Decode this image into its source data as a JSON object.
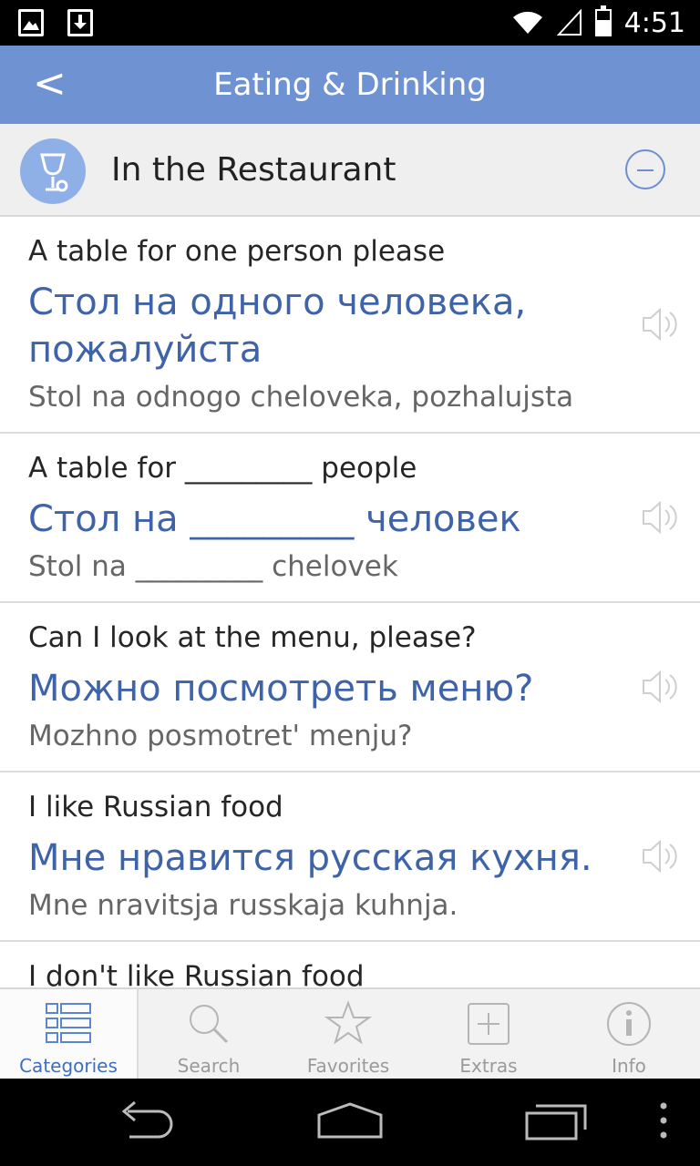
{
  "status_bar": {
    "time": "4:51"
  },
  "header": {
    "back_label": "<",
    "title": "Eating & Drinking"
  },
  "section": {
    "title": "In the Restaurant"
  },
  "phrases": [
    {
      "en": "A table for one person please",
      "ru": "Стол на одного человека, пожалуйста",
      "tr": "Stol na odnogo cheloveka, pozhalujsta"
    },
    {
      "en": "A table for _________ people",
      "ru": "Стол на _________ человек",
      "tr": "Stol na _________ chelovek"
    },
    {
      "en": "Can I look at the menu, please?",
      "ru": "Можно посмотреть меню?",
      "tr": "Mozhno posmotret' menju?"
    },
    {
      "en": "I like Russian food",
      "ru": "Мне нравится русская кухня.",
      "tr": "Mne nravitsja russkaja kuhnja."
    },
    {
      "en": "I don't like Russian food",
      "ru": "",
      "tr": ""
    }
  ],
  "tabs": [
    {
      "label": "Categories",
      "icon": "list-icon",
      "active": true
    },
    {
      "label": "Search",
      "icon": "search-icon",
      "active": false
    },
    {
      "label": "Favorites",
      "icon": "star-icon",
      "active": false
    },
    {
      "label": "Extras",
      "icon": "plus-box-icon",
      "active": false
    },
    {
      "label": "Info",
      "icon": "info-icon",
      "active": false
    }
  ],
  "colors": {
    "header": "#6f93d2",
    "russian_text": "#3f63a8",
    "active_tab": "#3f6ec0"
  }
}
